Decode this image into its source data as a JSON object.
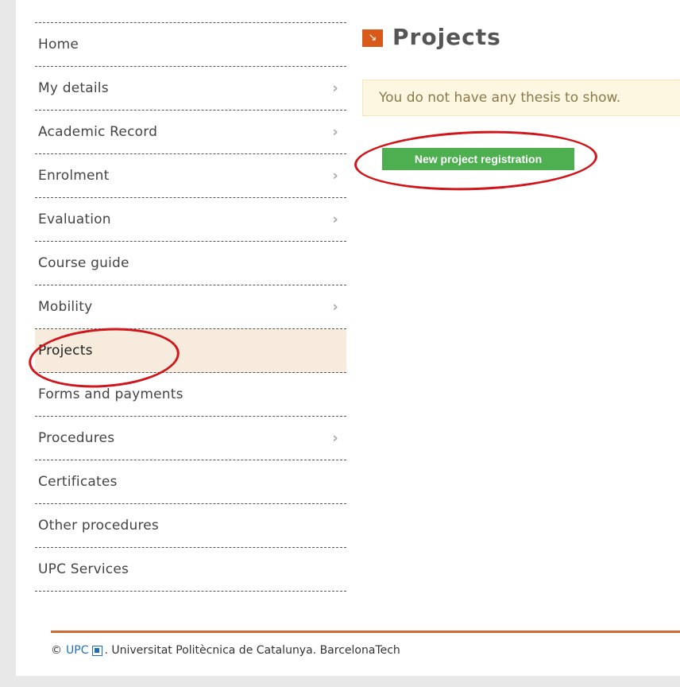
{
  "sidebar": {
    "items": [
      {
        "label": "Home",
        "chevron": false,
        "active": false
      },
      {
        "label": "My details",
        "chevron": true,
        "active": false
      },
      {
        "label": "Academic Record",
        "chevron": true,
        "active": false
      },
      {
        "label": "Enrolment",
        "chevron": true,
        "active": false
      },
      {
        "label": "Evaluation",
        "chevron": true,
        "active": false
      },
      {
        "label": "Course guide",
        "chevron": false,
        "active": false
      },
      {
        "label": "Mobility",
        "chevron": true,
        "active": false
      },
      {
        "label": "Projects",
        "chevron": false,
        "active": true
      },
      {
        "label": "Forms and payments",
        "chevron": false,
        "active": false
      },
      {
        "label": "Procedures",
        "chevron": true,
        "active": false
      },
      {
        "label": "Certificates",
        "chevron": false,
        "active": false
      },
      {
        "label": "Other procedures",
        "chevron": false,
        "active": false
      },
      {
        "label": "UPC Services",
        "chevron": false,
        "active": false
      }
    ],
    "chevron_glyph": "›"
  },
  "main": {
    "title": "Projects",
    "title_icon": "↘",
    "notice": "You do not have any thesis to show.",
    "new_button": "New project registration"
  },
  "footer": {
    "copyright": "©",
    "link": "UPC",
    "text": ". Universitat Politècnica de Catalunya. BarcelonaTech"
  },
  "colors": {
    "accent": "#d85a1a",
    "button": "#4daf4f",
    "annotation": "#d0161b",
    "active_item": "#f6ebdd",
    "notice_bg": "#fdf6e0"
  }
}
